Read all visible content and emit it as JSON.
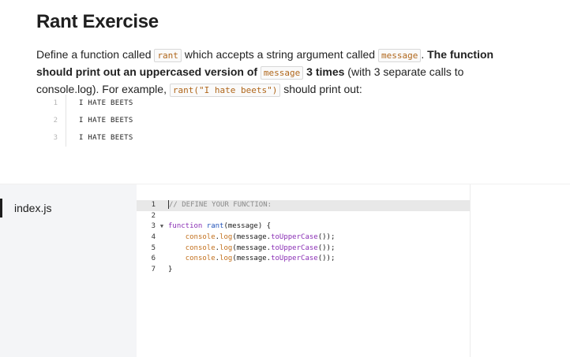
{
  "exercise": {
    "title": "Rant Exercise",
    "desc_1": "Define a function called ",
    "code_rant": "rant",
    "desc_2": " which accepts a string argument called ",
    "code_message": "message",
    "desc_3": ". ",
    "bold_1": "The function should print out an uppercased version of ",
    "code_message_2": "message",
    "bold_2": " 3 times",
    "desc_4": " (with 3 separate calls to console.log).  For example, ",
    "code_example": "rant(\"I hate beets\")",
    "desc_5": " should print out:",
    "sample_output": [
      {
        "no": "1",
        "text": "I HATE BEETS"
      },
      {
        "no": "2",
        "text": "I HATE BEETS"
      },
      {
        "no": "3",
        "text": "I HATE BEETS"
      }
    ]
  },
  "files": {
    "active": "index.js"
  },
  "editor": {
    "lines": [
      {
        "no": "1",
        "fold": "",
        "tokens": [
          [
            "cm",
            "// DEFINE YOUR FUNCTION:"
          ]
        ]
      },
      {
        "no": "2",
        "fold": "",
        "tokens": []
      },
      {
        "no": "3",
        "fold": "▼",
        "tokens": [
          [
            "kw",
            "function "
          ],
          [
            "fn",
            "rant"
          ],
          [
            "var",
            "("
          ],
          [
            "var",
            "message"
          ],
          [
            "var",
            ") {"
          ]
        ]
      },
      {
        "no": "4",
        "fold": "",
        "tokens": [
          [
            "var",
            "    "
          ],
          [
            "prop",
            "console"
          ],
          [
            "var",
            "."
          ],
          [
            "prop",
            "log"
          ],
          [
            "var",
            "(message."
          ],
          [
            "ppl",
            "toUpperCase"
          ],
          [
            "var",
            "());"
          ]
        ]
      },
      {
        "no": "5",
        "fold": "",
        "tokens": [
          [
            "var",
            "    "
          ],
          [
            "prop",
            "console"
          ],
          [
            "var",
            "."
          ],
          [
            "prop",
            "log"
          ],
          [
            "var",
            "(message."
          ],
          [
            "ppl",
            "toUpperCase"
          ],
          [
            "var",
            "());"
          ]
        ]
      },
      {
        "no": "6",
        "fold": "",
        "tokens": [
          [
            "var",
            "    "
          ],
          [
            "prop",
            "console"
          ],
          [
            "var",
            "."
          ],
          [
            "prop",
            "log"
          ],
          [
            "var",
            "(message."
          ],
          [
            "ppl",
            "toUpperCase"
          ],
          [
            "var",
            "());"
          ]
        ]
      },
      {
        "no": "7",
        "fold": "",
        "tokens": [
          [
            "var",
            "}"
          ]
        ]
      }
    ]
  }
}
